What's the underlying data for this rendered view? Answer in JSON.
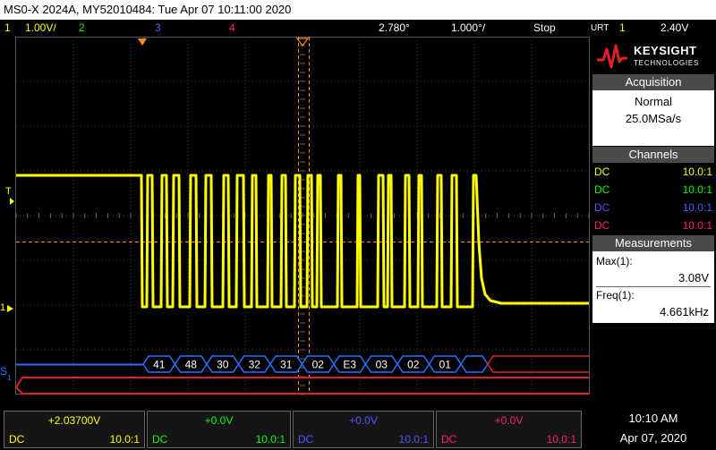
{
  "title": "MS0-X 2024A, MY52010484: Tue Apr 07 10:11:00 2020",
  "status": {
    "ch1_num": "1",
    "ch1_scale": "1.00V/",
    "ch2_num": "2",
    "ch3_num": "3",
    "ch4_num": "4",
    "time_pos": "2.780°",
    "time_scale": "1.000°/",
    "run_state": "Stop",
    "trig_mode": "URT",
    "trig_ch": "1",
    "trig_level": "2.40V"
  },
  "colors": {
    "ch1": "#ffff00",
    "ch2": "#00ff00",
    "ch3": "#5555ff",
    "ch4": "#ff2266",
    "bus": "#2f6fff",
    "cursor": "#ff8c1a"
  },
  "logo": {
    "brand": "KEYSIGHT",
    "sub": "TECHNOLOGIES"
  },
  "acquisition": {
    "header": "Acquisition",
    "mode": "Normal",
    "rate": "25.0MSa/s"
  },
  "channels": {
    "header": "Channels",
    "rows": [
      {
        "coupling": "DC",
        "probe": "10.0:1"
      },
      {
        "coupling": "DC",
        "probe": "10.0:1"
      },
      {
        "coupling": "DC",
        "probe": "10.0:1"
      },
      {
        "coupling": "DC",
        "probe": "10.0:1"
      }
    ]
  },
  "measurements": {
    "header": "Measurements",
    "items": [
      {
        "label": "Max(1):",
        "value": "3.08V"
      },
      {
        "label": "Freq(1):",
        "value": "4.661kHz"
      }
    ]
  },
  "markers": {
    "trigger_level": "T",
    "ground": "1",
    "bus_label": "S",
    "bus_sub": "1"
  },
  "bus_decode": [
    "41",
    "48",
    "30",
    "32",
    "31",
    "02",
    "E3",
    "03",
    "02",
    "01"
  ],
  "bottom": {
    "channels": [
      {
        "offset": "+2.03700V",
        "coupling": "DC",
        "probe": "10.0:1"
      },
      {
        "offset": "+0.0V",
        "coupling": "DC",
        "probe": "10.0:1"
      },
      {
        "offset": "+0.0V",
        "coupling": "DC",
        "probe": "10.0:1"
      },
      {
        "offset": "+0.0V",
        "coupling": "DC",
        "probe": "10.0:1"
      }
    ],
    "time": "10:10 AM",
    "date": "Apr 07, 2020"
  }
}
